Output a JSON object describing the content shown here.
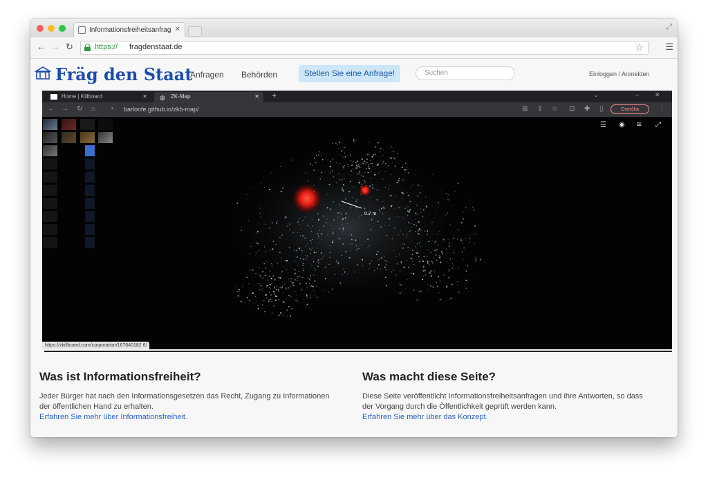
{
  "browser": {
    "tab_title": "Informationsfreiheitsanfrage",
    "url_protocol": "https://",
    "url_host": "fragdenstaat.de"
  },
  "site": {
    "logo_text": "Fräg den Staat",
    "nav": [
      "Anfragen",
      "Behörden"
    ],
    "cta_label": "Stellen Sie eine Anfrage!",
    "search_placeholder": "Suchen",
    "login_label": "Einloggen / Anmelden"
  },
  "screenshot": {
    "tabs": [
      {
        "label": "Home | Killboard"
      },
      {
        "label": "ZK-Map"
      }
    ],
    "url": "barlonfe.github.io/zkb-map/",
    "profile_label": "Oserčka",
    "map_label": "0.7 m",
    "status_url": "https://zkillboard.com/corporation/167040182 6/"
  },
  "info": {
    "left": {
      "heading": "Was ist Informationsfreiheit?",
      "text": "Jeder Bürger hat nach den Informationsgesetzen das Recht, Zugang zu Informationen der öffentlichen Hand zu erhalten.",
      "link": "Erfahren Sie mehr über Informationsfreiheit."
    },
    "right": {
      "heading": "Was macht diese Seite?",
      "text": "Diese Seite veröffentlicht Informationsfreiheitsanfragen und ihre Antworten, so dass der Vorgang durch die Öffentlichkeit geprüft werden kann.",
      "link": "Erfahren Sie mehr über das Konzept."
    }
  },
  "colors": {
    "accent": "#1d4dab",
    "cta_bg": "#cde6f8",
    "secure": "#2e9a3c",
    "hotspot": "#ff2a1a"
  }
}
